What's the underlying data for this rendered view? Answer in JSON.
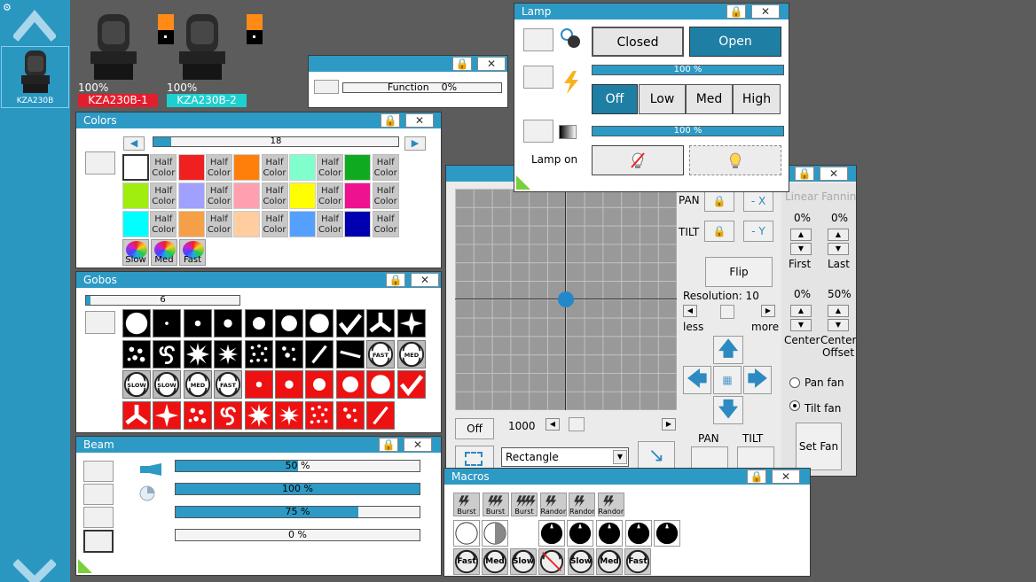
{
  "sidebar": {
    "fixture_label": "KZA230B"
  },
  "fixtures": [
    {
      "percent": "100%",
      "name": "KZA230B-1",
      "color": "#e21e2d"
    },
    {
      "percent": "100%",
      "name": "KZA230B-2",
      "color": "#1ecfd0"
    }
  ],
  "function_panel": {
    "text": "Function",
    "value": "0%"
  },
  "colors": {
    "title": "Colors",
    "slider_value": "18",
    "half_label": "Half Color",
    "swatches": [
      "#ffffff",
      "#f02020",
      "#ff7f0a",
      "#80ffcc",
      "#10aa20",
      "#a0ee10",
      "#a0a0ff",
      "#ff9fb0",
      "#ffff00",
      "#ee1290",
      "#00ffff",
      "#f5a048",
      "#ffcda0",
      "#55a0ff",
      "#0000b0"
    ],
    "speed_labels": [
      "Slow",
      "Med",
      "Fast"
    ]
  },
  "gobos": {
    "title": "Gobos",
    "slider_value": "6"
  },
  "beam": {
    "title": "Beam",
    "bars": [
      {
        "text": "50 %",
        "value": 0.5
      },
      {
        "text": "100 %",
        "value": 1.0
      },
      {
        "text": "75 %",
        "value": 0.75
      },
      {
        "text": "0 %",
        "value": 0.0
      }
    ]
  },
  "lamp": {
    "title": "Lamp",
    "closed": "Closed",
    "open": "Open",
    "bar1": "100 %",
    "bar2": "100 %",
    "off": "Off",
    "low": "Low",
    "med": "Med",
    "high": "High",
    "lamp_on": "Lamp on"
  },
  "pantilt": {
    "pan": "PAN",
    "tilt": "TILT",
    "neg_x": "- X",
    "neg_y": "- Y",
    "flip": "Flip",
    "resolution": "Resolution: 10",
    "less": "less",
    "more": "more",
    "off": "Off",
    "speed": "1000",
    "shape": "Rectangle",
    "pan_bottom": "PAN",
    "tilt_bottom": "TILT"
  },
  "fanning": {
    "title": "Linear Fanning",
    "first_pct": "0%",
    "last_pct": "0%",
    "first": "First",
    "last": "Last",
    "center_pct": "0%",
    "offset_pct": "50%",
    "center": "Center",
    "center_offset": "Center Offset",
    "pan_fan": "Pan fan",
    "tilt_fan": "Tilt fan",
    "set_fan": "Set Fan"
  },
  "macros": {
    "title": "Macros",
    "row1": [
      "Burst",
      "Burst",
      "Burst",
      "Random",
      "Random",
      "Random"
    ],
    "row3": [
      "Fast",
      "Med",
      "Slow",
      "",
      "Slow",
      "Med",
      "Fast"
    ]
  },
  "window_buttons": {
    "lock": "🔒",
    "close": "✕"
  }
}
